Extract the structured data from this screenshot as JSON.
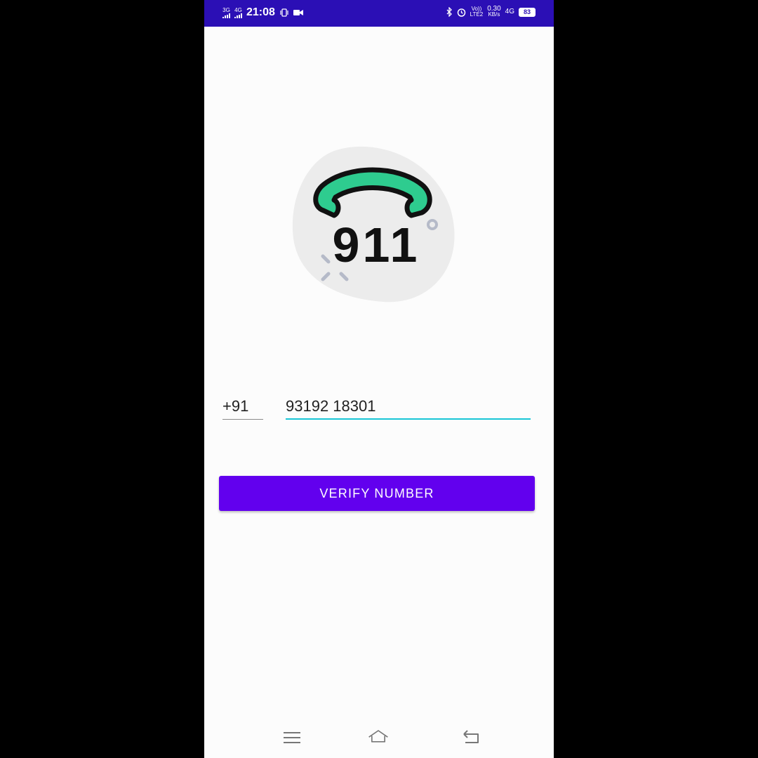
{
  "status_bar": {
    "net1": "3G",
    "net2": "4G",
    "time": "21:08",
    "volte": "Vo))",
    "lte": "LTE2",
    "speed_value": "0.30",
    "speed_unit": "KB/s",
    "net3": "4G",
    "battery": "83"
  },
  "logo": {
    "text": "911",
    "colors": {
      "handset": "#2ecc8f",
      "outline": "#111111",
      "blob": "#ececec",
      "accent": "#b5bac8"
    }
  },
  "form": {
    "country_code": "+91",
    "phone_number": "93192 18301"
  },
  "verify_button": {
    "label": "VERIFY NUMBER",
    "color": "#6200ee"
  },
  "nav_bar": {
    "icons": [
      "menu-icon",
      "home-icon",
      "back-icon"
    ]
  }
}
